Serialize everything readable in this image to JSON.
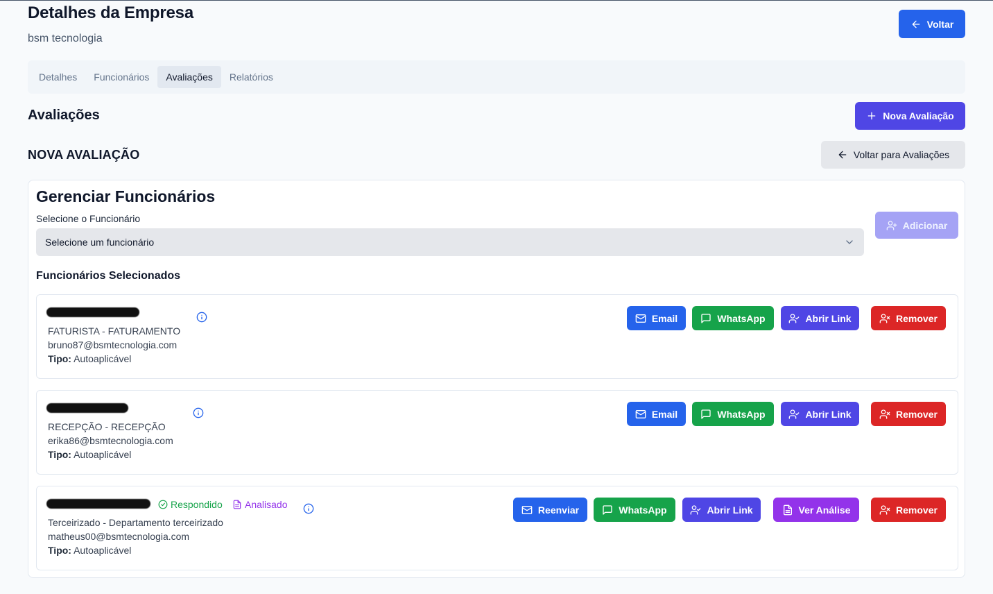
{
  "header": {
    "title": "Detalhes da Empresa",
    "company": "bsm tecnologia",
    "back_label": "Voltar"
  },
  "tabs": [
    {
      "label": "Detalhes",
      "active": false
    },
    {
      "label": "Funcionários",
      "active": false
    },
    {
      "label": "Avaliações",
      "active": true
    },
    {
      "label": "Relatórios",
      "active": false
    }
  ],
  "section": {
    "title": "Avaliações",
    "new_label": "Nova Avaliação",
    "subtitle": "NOVA AVALIAÇÃO",
    "back_list_label": "Voltar para Avaliações"
  },
  "card": {
    "title": "Gerenciar Funcionários",
    "select_label": "Selecione o Funcionário",
    "select_value": "Selecione um funcionário",
    "add_label": "Adicionar",
    "selected_title": "Funcionários Selecionados"
  },
  "employees": [
    {
      "role": "FATURISTA - FATURAMENTO",
      "email": "bruno87@bsmtecnologia.com",
      "type_label": "Tipo:",
      "type": "Autoaplicável",
      "actions": {
        "email": "Email",
        "whatsapp": "WhatsApp",
        "link": "Abrir Link",
        "remove": "Remover"
      }
    },
    {
      "role": "RECEPÇÃO - RECEPÇÃO",
      "email": "erika86@bsmtecnologia.com",
      "type_label": "Tipo:",
      "type": "Autoaplicável",
      "actions": {
        "email": "Email",
        "whatsapp": "WhatsApp",
        "link": "Abrir Link",
        "remove": "Remover"
      }
    },
    {
      "role": "Terceirizado - Departamento terceirizado",
      "email": "matheus00@bsmtecnologia.com",
      "type_label": "Tipo:",
      "type": "Autoaplicável",
      "status_responded": "Respondido",
      "status_analyzed": "Analisado",
      "actions": {
        "resend": "Reenviar",
        "whatsapp": "WhatsApp",
        "link": "Abrir Link",
        "analysis": "Ver Análise",
        "remove": "Remover"
      }
    }
  ],
  "colors": {
    "primary": "#2563eb",
    "indigo": "#4f46e5",
    "green": "#16a34a",
    "red": "#dc2626",
    "purple": "#9333ea"
  }
}
